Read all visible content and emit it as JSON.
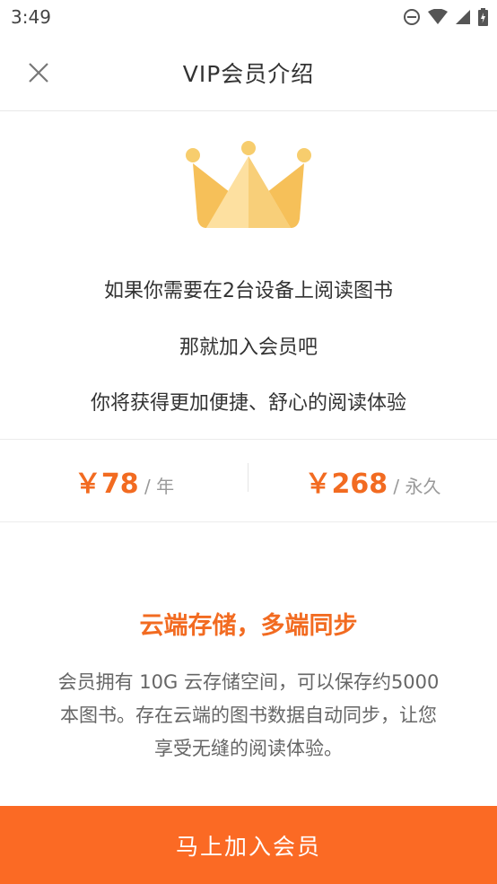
{
  "status_bar": {
    "time": "3:49"
  },
  "header": {
    "title": "VIP会员介绍"
  },
  "hero": {
    "lines": [
      "如果你需要在2台设备上阅读图书",
      "那就加入会员吧",
      "你将获得更加便捷、舒心的阅读体验"
    ]
  },
  "pricing": {
    "options": [
      {
        "price": "￥78",
        "period": " / 年"
      },
      {
        "price": "￥268",
        "period": " / 永久"
      }
    ]
  },
  "feature": {
    "title": "云端存储，多端同步",
    "description": "会员拥有 10G 云存储空间，可以保存约5000本图书。存在云端的图书数据自动同步，让您享受无缝的阅读体验。"
  },
  "cta": {
    "label": "马上加入会员"
  },
  "colors": {
    "accent": "#f26b21",
    "button": "#fb6a24",
    "crown": "#f5c464"
  }
}
